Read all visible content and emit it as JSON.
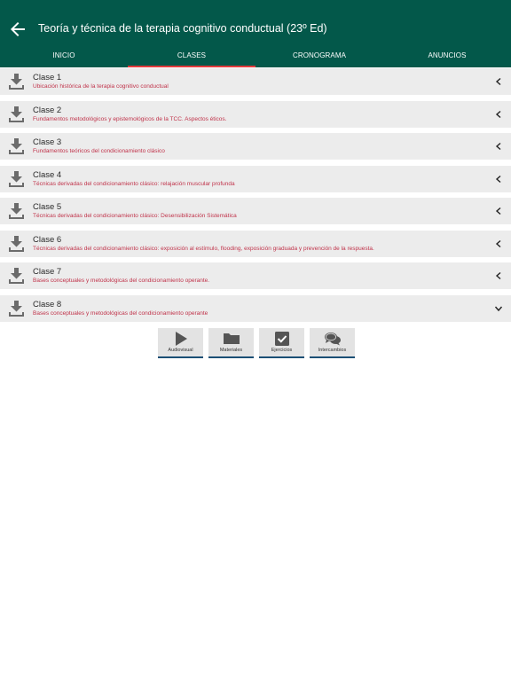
{
  "header": {
    "title": "Teoría y técnica de la terapia cognitivo conductual (23º Ed)",
    "back_icon": "arrow-left-icon"
  },
  "tabs": [
    {
      "label": "INICIO",
      "active": false
    },
    {
      "label": "CLASES",
      "active": true
    },
    {
      "label": "CRONOGRAMA",
      "active": false
    },
    {
      "label": "ANUNCIOS",
      "active": false
    }
  ],
  "classes": [
    {
      "title": "Clase 1",
      "subtitle": "Ubicación histórica de la terapia cognitivo conductual",
      "expanded": false
    },
    {
      "title": "Clase 2",
      "subtitle": "Fundamentos metodológicos y epistemológicos de la TCC. Aspectos éticos.",
      "expanded": false
    },
    {
      "title": "Clase 3",
      "subtitle": "Fundamentos teóricos del condicionamiento clásico",
      "expanded": false
    },
    {
      "title": "Clase 4",
      "subtitle": "Técnicas derivadas del condicionamiento clásico: relajación muscular profunda",
      "expanded": false
    },
    {
      "title": "Clase 5",
      "subtitle": "Técnicas derivadas del condicionamiento clásico: Desensibilización Sistemática",
      "expanded": false
    },
    {
      "title": "Clase 6",
      "subtitle": "Técnicas derivadas del condicionamiento clásico: exposición al estímulo, flooding, exposición graduada y prevención de la respuesta.",
      "expanded": false
    },
    {
      "title": "Clase 7",
      "subtitle": "Bases conceptuales y metodológicas del condicionamiento operante.",
      "expanded": false
    },
    {
      "title": "Clase 8",
      "subtitle": "Bases conceptuales y metodológicas del condicionamiento operante",
      "expanded": true
    }
  ],
  "tools": [
    {
      "label": "Audiovisual",
      "icon": "play-icon"
    },
    {
      "label": "Materiales",
      "icon": "folder-icon"
    },
    {
      "label": "Ejercicios",
      "icon": "checkbox-icon"
    },
    {
      "label": "Intercambios",
      "icon": "chat-bubbles-icon"
    }
  ],
  "colors": {
    "appbar": "#03584a",
    "tab_indicator": "#e23b3b",
    "subtitle": "#c0334a",
    "row_bg": "#ececec",
    "tool_underline": "#1b4f75"
  }
}
